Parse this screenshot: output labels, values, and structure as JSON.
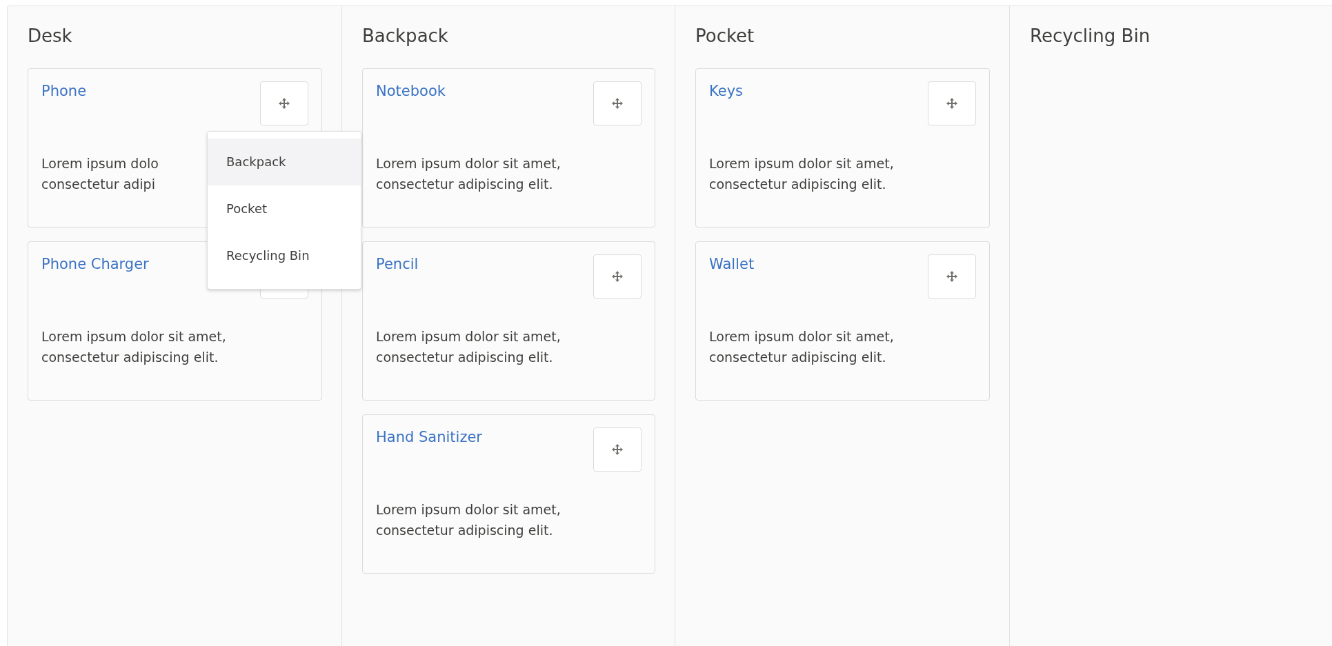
{
  "columns": [
    {
      "title": "Desk",
      "cards": [
        {
          "title": "Phone",
          "lines": [
            "Lorem ipsum dolo",
            "consectetur adipi"
          ],
          "menu": {
            "items": [
              {
                "label": "Backpack",
                "selected": true
              },
              {
                "label": "Pocket",
                "selected": false
              },
              {
                "label": "Recycling Bin",
                "selected": false
              }
            ]
          }
        },
        {
          "title": "Phone Charger",
          "lines": [
            "Lorem ipsum dolor sit amet,",
            "consectetur adipiscing elit."
          ]
        }
      ]
    },
    {
      "title": "Backpack",
      "cards": [
        {
          "title": "Notebook",
          "lines": [
            "Lorem ipsum dolor sit amet,",
            "consectetur adipiscing elit."
          ]
        },
        {
          "title": "Pencil",
          "lines": [
            "Lorem ipsum dolor sit amet,",
            "consectetur adipiscing elit."
          ]
        },
        {
          "title": "Hand Sanitizer",
          "lines": [
            "Lorem ipsum dolor sit amet,",
            "consectetur adipiscing elit."
          ]
        }
      ]
    },
    {
      "title": "Pocket",
      "cards": [
        {
          "title": "Keys",
          "lines": [
            "Lorem ipsum dolor sit amet,",
            "consectetur adipiscing elit."
          ]
        },
        {
          "title": "Wallet",
          "lines": [
            "Lorem ipsum dolor sit amet,",
            "consectetur adipiscing elit."
          ]
        }
      ]
    },
    {
      "title": "Recycling Bin"
    }
  ]
}
